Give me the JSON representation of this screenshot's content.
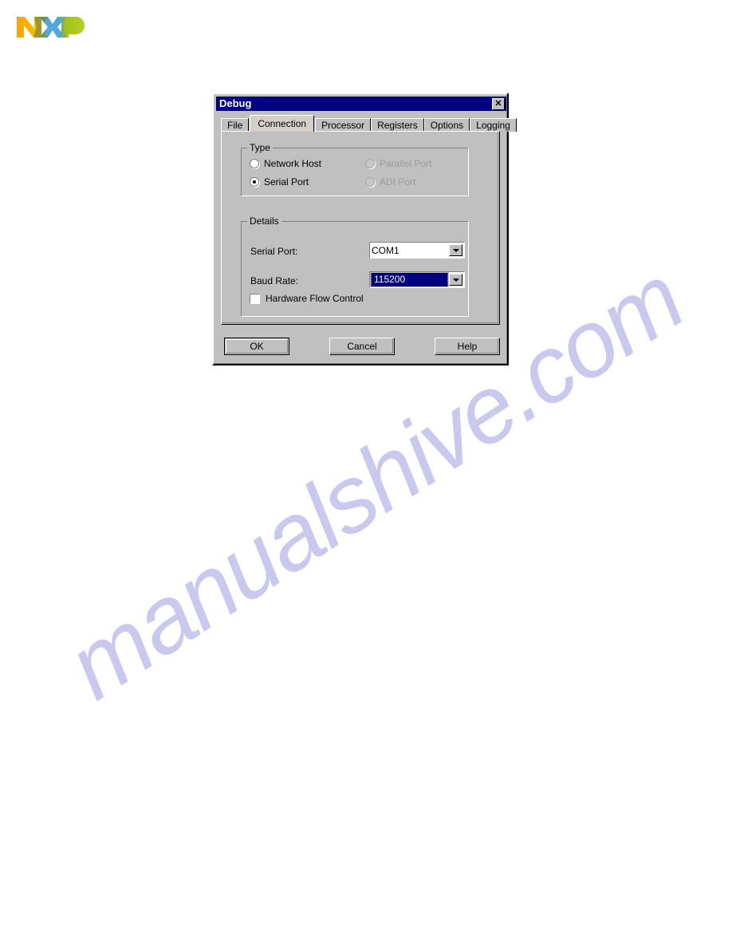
{
  "page": {
    "background_color": "#ffffff",
    "watermark": {
      "text": "manualshive.com",
      "color": "#c9c9ef",
      "rotation_deg": -33
    }
  },
  "logo": {
    "name": "NXP",
    "letters": [
      "N",
      "X",
      "P"
    ],
    "colors": {
      "orange": "#f7a600",
      "yellow": "#f5c400",
      "blue": "#3faee0",
      "teal": "#4ba6b8",
      "green": "#a4c400",
      "olive": "#8aa23c"
    }
  },
  "dialog": {
    "title": "Debug",
    "titlebar_color": "#000080",
    "face_color": "#c0c0c0",
    "close_button_glyph": "✕",
    "tabs": [
      {
        "label": "File",
        "selected": false
      },
      {
        "label": "Connection",
        "selected": true
      },
      {
        "label": "Processor",
        "selected": false
      },
      {
        "label": "Registers",
        "selected": false
      },
      {
        "label": "Options",
        "selected": false
      },
      {
        "label": "Logging",
        "selected": false
      }
    ],
    "type_group": {
      "title": "Type",
      "options": [
        {
          "label": "Network Host",
          "checked": false,
          "enabled": true
        },
        {
          "label": "Parallel Port",
          "checked": false,
          "enabled": false
        },
        {
          "label": "Serial Port",
          "checked": true,
          "enabled": true
        },
        {
          "label": "ADI Port",
          "checked": false,
          "enabled": false
        }
      ]
    },
    "details_group": {
      "title": "Details",
      "serial_port": {
        "label": "Serial Port:",
        "value": "COM1",
        "focused": false
      },
      "baud_rate": {
        "label": "Baud Rate:",
        "value": "115200",
        "focused": true,
        "selection_color": "#000080",
        "selection_text_color": "#ffffff"
      },
      "hardware_flow_control": {
        "label": "Hardware Flow Control",
        "checked": false
      }
    },
    "buttons": {
      "ok": "OK",
      "cancel": "Cancel",
      "help": "Help"
    }
  }
}
